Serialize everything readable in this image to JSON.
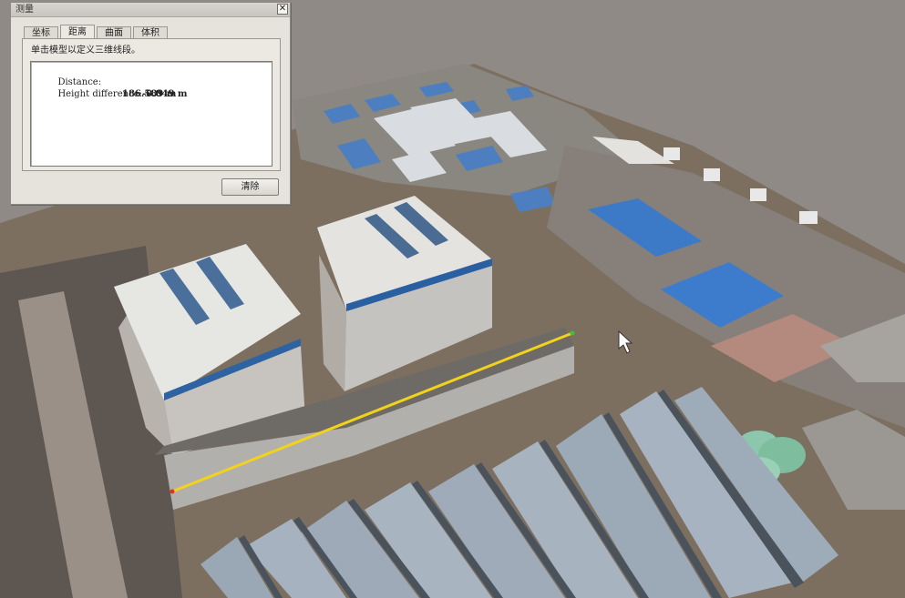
{
  "dialog": {
    "title": "测量",
    "close_glyph": "✕",
    "tabs": [
      {
        "label": "坐标",
        "active": false
      },
      {
        "label": "距离",
        "active": true
      },
      {
        "label": "曲面",
        "active": false
      },
      {
        "label": "体积",
        "active": false
      }
    ],
    "instruction": "单击模型以定义三维线段。",
    "results": {
      "distance_label": "Distance:",
      "distance_value": "186.589 m",
      "height_label": "Height difference:",
      "height_value": "-0.049 m"
    },
    "clear_button": "清除"
  },
  "viewport": {
    "description_icon": "cursor-arrow-icon",
    "measure_line_color": "#f2d21a",
    "start_point_color": "#e0321e",
    "end_point_color": "#3cc23a"
  }
}
